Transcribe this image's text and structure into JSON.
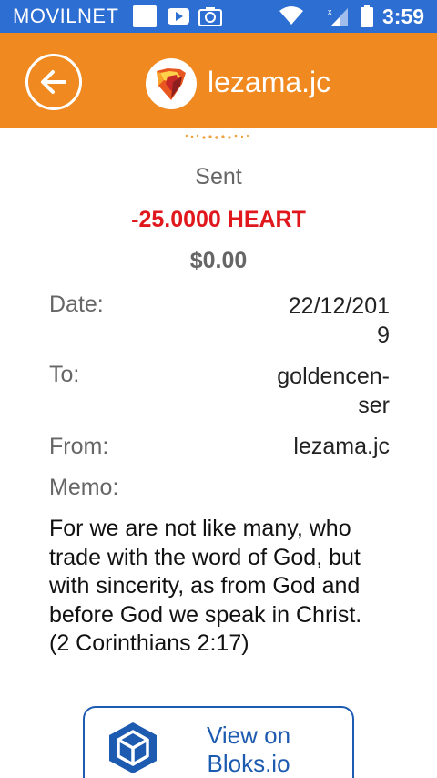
{
  "status_bar": {
    "carrier": "MOVILNET",
    "time": "3:59"
  },
  "app_bar": {
    "title": "lezama.jc",
    "accent_color": "#f0891f"
  },
  "transaction": {
    "direction": "Sent",
    "amount": "-25.0000 HEART",
    "fiat_value": "$0.00",
    "date_label": "Date:",
    "date_line1": "22/12/201",
    "date_line2": "9",
    "to_label": "To:",
    "to_line1": "goldencen-",
    "to_line2": "ser",
    "from_label": "From:",
    "from_value": "lezama.jc",
    "memo_label": "Memo:",
    "memo_lines": [
      "For we are not like many, who",
      "trade with the word of God, but",
      "with sincerity, as from God and",
      "before God we speak in Christ.",
      "(2 Corinthians 2:17)"
    ]
  },
  "bloks_button": {
    "line1": "View on",
    "line2": "Bloks.io"
  }
}
